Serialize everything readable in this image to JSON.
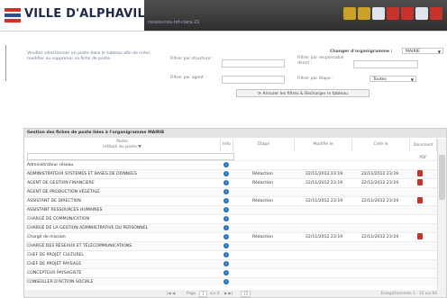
{
  "header": {
    "title": "VILLE D'ALPHAVILLE",
    "subtitle": "ressources-ref-clara-21",
    "logo_colors": [
      "#d7302a",
      "#2c4d9a",
      "#d7302a"
    ],
    "band_color": "#3b3b3b",
    "icons": [
      {
        "name": "people-icon",
        "color": "#c9a227"
      },
      {
        "name": "people-add-icon",
        "color": "#c9a227"
      },
      {
        "name": "document-icon",
        "color": "#dfe4ea"
      },
      {
        "name": "stop-icon",
        "color": "#c7332a"
      },
      {
        "name": "power-icon",
        "color": "#c7332a"
      },
      {
        "name": "home-icon",
        "color": "#dfe4ea"
      },
      {
        "name": "settings-icon",
        "color": "#c7332a"
      }
    ]
  },
  "instructions": "Veuillez sélectionner un poste dans le tableau afin de créer, modifier ou supprimer sa fiche de poste.",
  "filters": {
    "structure_label": "Filtrer par structure :",
    "agent_label": "Filtrer par agent :",
    "resp_label": "Filtrer par responsable direct :",
    "etape_label": "Filtrer par étape :",
    "etape_value": "Toutes",
    "orga_label": "Changer d'organigramme :",
    "orga_value": "MAIRIE",
    "reset_button": "Annuler les filtres & Recharger le tableau"
  },
  "grid": {
    "caption": "Gestion des fiches de poste liées à l'organigramme MAIRIE",
    "columns": {
      "poste": "Poste",
      "poste_sub": "Intitulé du poste ▼",
      "info": "Info",
      "etape": "Étape",
      "modifie": "Modifié le",
      "cree": "Créé le",
      "pdf": "Document PDF"
    },
    "rows": [
      {
        "poste": "Administrateur réseau",
        "etape": "",
        "modifie": "",
        "cree": "",
        "pdf": false
      },
      {
        "poste": "ADMINISTRATEUR SYSTEMES ET BASES DE DONNEES",
        "etape": "Rédaction",
        "modifie": "22/11/2012 23:19",
        "cree": "22/11/2012 23:19",
        "pdf": true
      },
      {
        "poste": "AGENT DE GESTION FINANCIERE",
        "etape": "Rédaction",
        "modifie": "22/11/2012 23:19",
        "cree": "22/11/2012 23:19",
        "pdf": true
      },
      {
        "poste": "AGENT DE PRODUCTION VÉGÉTALE",
        "etape": "",
        "modifie": "",
        "cree": "",
        "pdf": false
      },
      {
        "poste": "ASSISTANT DE DIRECTION",
        "etape": "Rédaction",
        "modifie": "22/11/2012 23:19",
        "cree": "22/11/2012 23:19",
        "pdf": true
      },
      {
        "poste": "ASSISTANT RESSOURCES HUMAINES",
        "etape": "",
        "modifie": "",
        "cree": "",
        "pdf": false
      },
      {
        "poste": "CHARGÉ DE COMMUNICATION",
        "etape": "",
        "modifie": "",
        "cree": "",
        "pdf": false
      },
      {
        "poste": "CHARGÉ DE LA GESTION ADMINISTRATIVE DU PERSONNEL",
        "etape": "",
        "modifie": "",
        "cree": "",
        "pdf": false
      },
      {
        "poste": "Chargé de mission",
        "etape": "Rédaction",
        "modifie": "22/11/2012 23:19",
        "cree": "22/11/2012 23:19",
        "pdf": true
      },
      {
        "poste": "CHARGÉ DES RÉSEAUX ET TÉLÉCOMMUNICATIONS",
        "etape": "",
        "modifie": "",
        "cree": "",
        "pdf": false
      },
      {
        "poste": "CHEF DE PROJET CULTUREL",
        "etape": "",
        "modifie": "",
        "cree": "",
        "pdf": false
      },
      {
        "poste": "CHEF DE PROJET PAYSAGE",
        "etape": "",
        "modifie": "",
        "cree": "",
        "pdf": false
      },
      {
        "poste": "CONCEPTEUR PAYSAGISTE",
        "etape": "",
        "modifie": "",
        "cree": "",
        "pdf": false
      },
      {
        "poste": "CONSEILLER D'ACTION SOCIALE",
        "etape": "",
        "modifie": "",
        "cree": "",
        "pdf": false
      }
    ],
    "pager": {
      "page_label": "Page",
      "page_value": "1",
      "of_label": "sur 4",
      "per_page": "15",
      "count": "Enregistrements 1 - 15 sur 60"
    }
  }
}
